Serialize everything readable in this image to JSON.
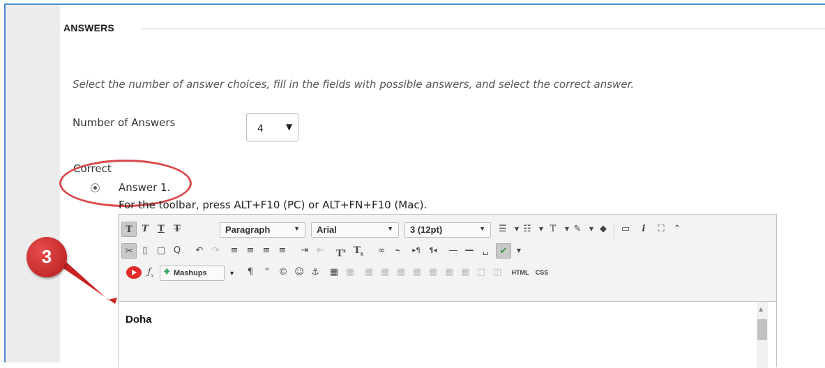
{
  "section": {
    "title": "ANSWERS"
  },
  "instructions": "Select the number of answer choices, fill in the fields with possible answers, and select the correct answer.",
  "number_of_answers": {
    "label": "Number of Answers",
    "value": "4"
  },
  "correct_label": "Correct",
  "answer": {
    "label": "Answer 1.",
    "selected": true
  },
  "toolbar_hint": "For the toolbar, press ALT+F10 (PC) or ALT+FN+F10 (Mac).",
  "editor": {
    "paragraph_format": "Paragraph",
    "font_family": "Arial",
    "font_size": "3 (12pt)",
    "mashups_label": "Mashups",
    "html_label": "HTML",
    "css_label": "CSS",
    "content": "Doha"
  },
  "callout_number": "3",
  "colors": {
    "accent_border": "#4e8ccc",
    "annotation_red": "#d9494b"
  }
}
